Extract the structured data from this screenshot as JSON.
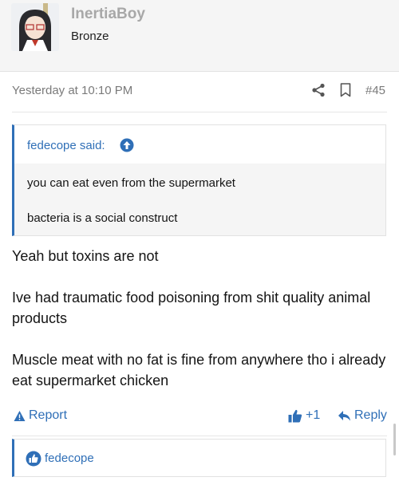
{
  "user": {
    "name": "InertiaBoy",
    "rank": "Bronze"
  },
  "post": {
    "timestamp": "Yesterday at 10:10 PM",
    "number": "#45"
  },
  "quote": {
    "author_label": "fedecope said:",
    "lines": [
      "you can eat even from the supermarket",
      "bacteria is a social construct"
    ]
  },
  "message": {
    "paragraphs": [
      "Yeah but toxins are not",
      "Ive had traumatic food poisoning from shit quality animal products",
      "Muscle meat with no fat is fine from anywhere tho i already eat supermarket chicken"
    ]
  },
  "actions": {
    "report": "Report",
    "like_count": "+1",
    "reply": "Reply"
  },
  "reactions": {
    "user": "fedecope"
  },
  "colors": {
    "link": "#2f6fb7",
    "header_bg": "#f5f5f5",
    "quote_bg": "#f5f5f5"
  },
  "icons": [
    "share-icon",
    "bookmark-icon",
    "arrow-up-icon",
    "warning-icon",
    "thumbs-up-icon",
    "reply-arrow-icon",
    "like-reaction-icon"
  ]
}
